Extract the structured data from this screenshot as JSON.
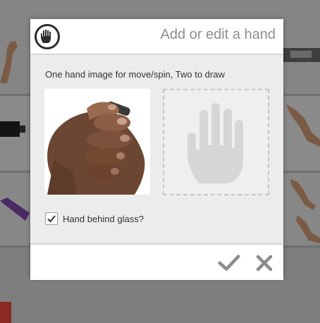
{
  "dialog": {
    "title": "Add or edit a hand",
    "description": "One hand image for move/spin, Two to draw",
    "checkbox": {
      "label": "Hand behind glass?",
      "checked": true
    },
    "slots": [
      {
        "state": "hand-photo"
      },
      {
        "state": "empty"
      }
    ],
    "buttons": {
      "confirm_icon": "checkmark-icon",
      "cancel_icon": "close-icon"
    }
  },
  "icons": {
    "logo": "hand-stop-icon",
    "placeholder": "hand-placeholder-icon"
  },
  "colors": {
    "header_bg": "#ffffff",
    "body_bg": "#ececec",
    "title_text": "#8f8f8f",
    "button_icon": "#8c8c8c",
    "overlay_bg": "#7c7c7c"
  }
}
